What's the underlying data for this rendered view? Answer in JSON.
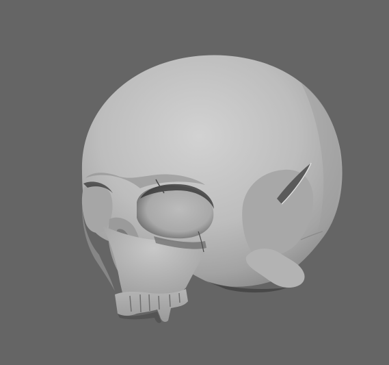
{
  "viewport": {
    "background_color": "#656565",
    "object": "skull-model",
    "material_color": "#b9b9b9",
    "shadow_color": "#3a3a3a"
  }
}
